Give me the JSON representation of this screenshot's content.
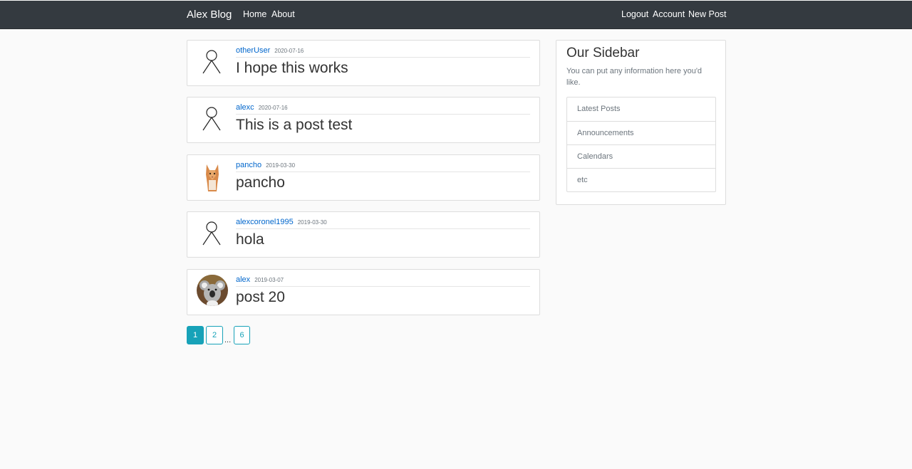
{
  "navbar": {
    "brand": "Alex Blog",
    "left_links": [
      "Home",
      "About"
    ],
    "right_links": [
      "Logout",
      "Account",
      "New Post"
    ]
  },
  "posts": [
    {
      "author": "otherUser",
      "date": "2020-07-16",
      "title": "I hope this works",
      "avatar": "default-stick-figure"
    },
    {
      "author": "alexc",
      "date": "2020-07-16",
      "title": "This is a post test",
      "avatar": "default-stick-figure"
    },
    {
      "author": "pancho",
      "date": "2019-03-30",
      "title": "pancho",
      "avatar": "cat-photo"
    },
    {
      "author": "alexcoronel1995",
      "date": "2019-03-30",
      "title": "hola",
      "avatar": "default-stick-figure"
    },
    {
      "author": "alex",
      "date": "2019-03-07",
      "title": "post 20",
      "avatar": "koala-photo"
    }
  ],
  "pagination": {
    "pages": [
      "1",
      "2",
      "6"
    ],
    "ellipsis": "...",
    "active": "1"
  },
  "sidebar": {
    "title": "Our Sidebar",
    "text": "You can put any information here you'd like.",
    "items": [
      "Latest Posts",
      "Announcements",
      "Calendars",
      "etc"
    ]
  },
  "colors": {
    "navbar_bg": "#343a40",
    "link": "#0066cc",
    "accent": "#17a2b8",
    "page_bg": "#fafafa"
  }
}
